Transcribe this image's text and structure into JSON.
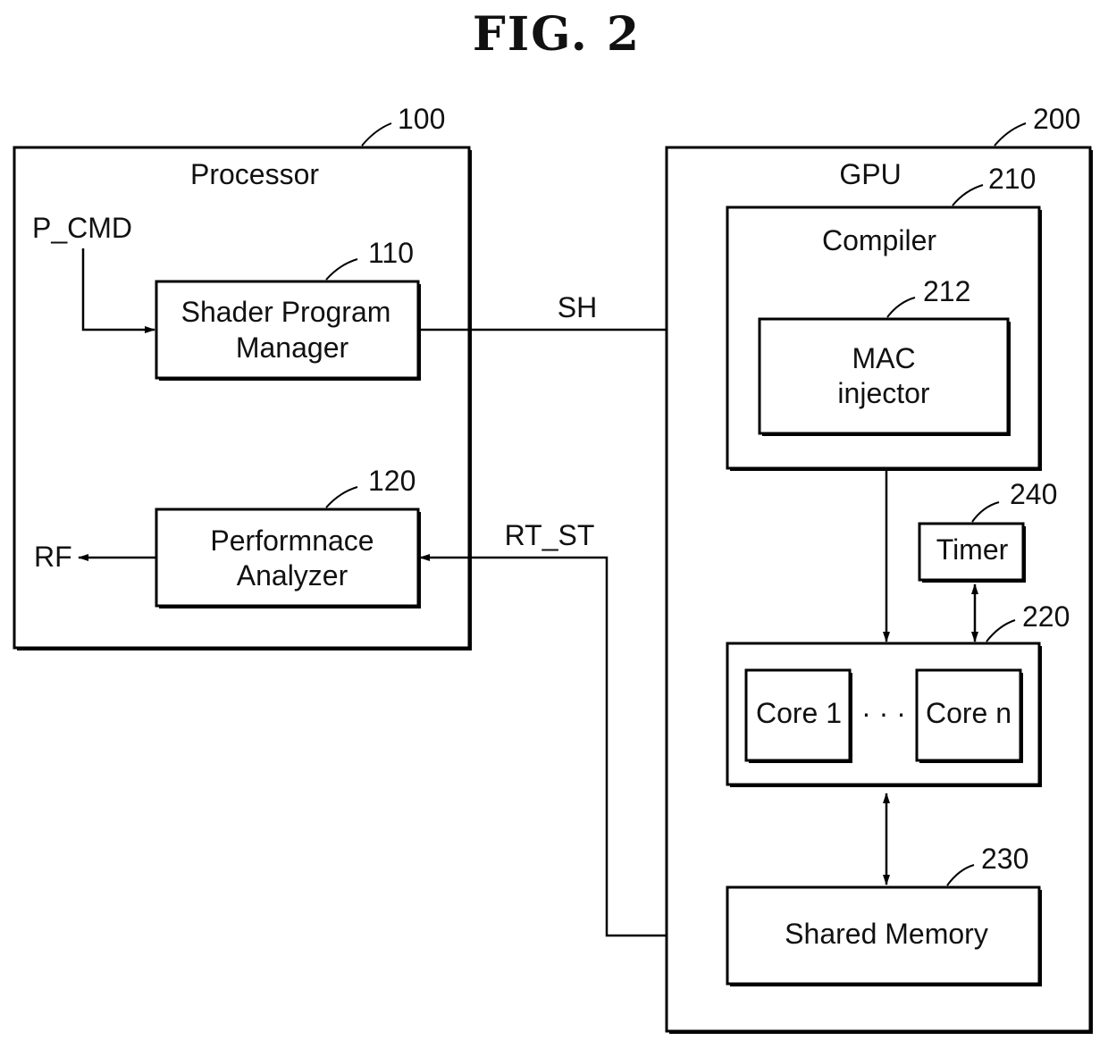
{
  "figure": {
    "title": "FIG. 2"
  },
  "blocks": {
    "processor": {
      "ref": "100",
      "label": "Processor"
    },
    "shader_program_manager": {
      "ref": "110",
      "line1": "Shader Program",
      "line2": "Manager"
    },
    "performance_analyzer": {
      "ref": "120",
      "line1": "Performnace",
      "line2": "Analyzer"
    },
    "gpu": {
      "ref": "200",
      "label": "GPU"
    },
    "compiler": {
      "ref": "210",
      "label": "Compiler"
    },
    "mac_injector": {
      "ref": "212",
      "line1": "MAC",
      "line2": "injector"
    },
    "core_group": {
      "ref": "220",
      "core_first": "Core 1",
      "core_last": "Core n",
      "ellipsis": "· · ·"
    },
    "shared_memory": {
      "ref": "230",
      "label": "Shared Memory"
    },
    "timer": {
      "ref": "240",
      "label": "Timer"
    }
  },
  "signals": {
    "p_cmd": "P_CMD",
    "sh": "SH",
    "rt_st": "RT_ST",
    "rf": "RF"
  }
}
